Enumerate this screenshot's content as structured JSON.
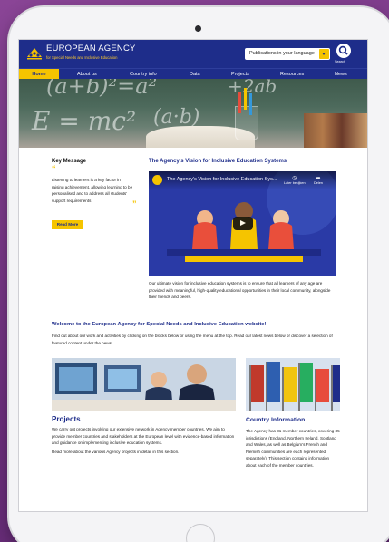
{
  "header": {
    "org_title": "EUROPEAN AGENCY",
    "org_subtitle": "for Special Needs and Inclusive Education",
    "language_selector": "Publications in your language",
    "search_label": "Search"
  },
  "nav": {
    "items": [
      {
        "label": "Home",
        "active": true
      },
      {
        "label": "About us"
      },
      {
        "label": "Country info"
      },
      {
        "label": "Data"
      },
      {
        "label": "Projects"
      },
      {
        "label": "Resources"
      },
      {
        "label": "News"
      }
    ]
  },
  "key_message": {
    "heading": "Key Message",
    "open_quote": "“",
    "text": "Listening to learners is a key factor in raising achievement, allowing learning to be personalised and to address all students’ support requirements",
    "close_quote": "”",
    "button": "Read More"
  },
  "vision": {
    "heading": "The Agency's Vision for Inclusive Education Systems",
    "video_title": "The Agency's Vision for Inclusive Education Sys...",
    "watch_later": "Later bekijken",
    "share": "Delen",
    "text": "Our ultimate vision for inclusive education systems is to ensure that all learners of any age are provided with meaningful, high-quality educational opportunities in their local community, alongside their friends and peers."
  },
  "welcome": {
    "heading": "Welcome to the European Agency for Special Needs and Inclusive Education website!",
    "text": "Find out about our work and activities by clicking on the blocks below or using the menu at the top. Read our latest news below or discover a selection of featured content under the news."
  },
  "projects": {
    "heading": "Projects",
    "text1": "We carry out projects involving our extensive network in Agency member countries. We aim to provide member countries and stakeholders at the European level with evidence-based information and guidance on implementing inclusive education systems.",
    "text2": "Read more about the various Agency projects in detail in this section."
  },
  "country": {
    "heading": "Country Information",
    "text": "The Agency has 31 member countries, covering 35 jurisdictions (England, Northern Ireland, Scotland and Wales, as well as Belgium’s French and Flemish communities are each represented separately). This section contains information about each of the member countries."
  },
  "side_tools": [
    "zoom-in",
    "zoom-out",
    "accessibility",
    "reset",
    "print",
    "help"
  ],
  "colors": {
    "brand_blue": "#1e2d8a",
    "accent_yellow": "#f5c400",
    "background_purple": "#7a3a88"
  }
}
